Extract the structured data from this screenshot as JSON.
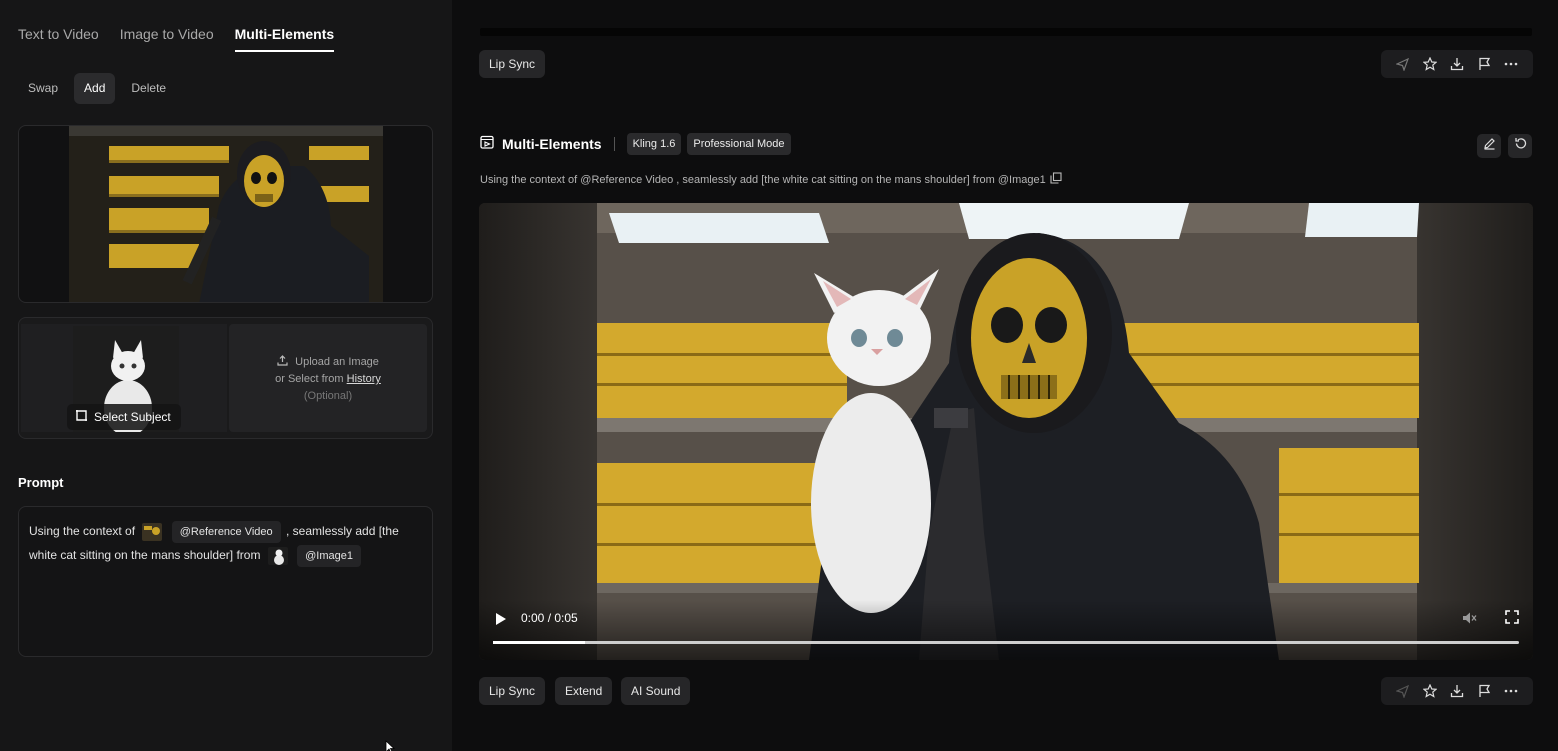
{
  "tabs": [
    "Text to Video",
    "Image to Video",
    "Multi-Elements"
  ],
  "subtabs": [
    "Swap",
    "Add",
    "Delete"
  ],
  "image_slot": {
    "select_subject": "Select Subject",
    "upload_line1": "Upload an Image",
    "upload_line2_prefix": "or Select from",
    "upload_history": "History",
    "upload_optional": "(Optional)"
  },
  "prompt": {
    "label": "Prompt",
    "text1": "Using the context of",
    "chip_video": "@Reference Video",
    "text2": ", seamlessly add [the white cat sitting on the mans shoulder] from",
    "chip_image": "@Image1"
  },
  "top_actions": {
    "lip_sync": "Lip Sync"
  },
  "result": {
    "title": "Multi-Elements",
    "model": "Kling 1.6",
    "mode": "Professional Mode",
    "prompt_line": "Using the context of @Reference Video , seamlessly add [the white cat sitting on the mans shoulder] from @Image1"
  },
  "video": {
    "time": "0:00 / 0:05",
    "progress_fraction": 0.09
  },
  "bottom_actions": {
    "lip_sync": "Lip Sync",
    "extend": "Extend",
    "ai_sound": "AI Sound"
  },
  "colors": {
    "background": "#0d0d0e",
    "panel": "#161617",
    "gold": "#c9a227"
  }
}
